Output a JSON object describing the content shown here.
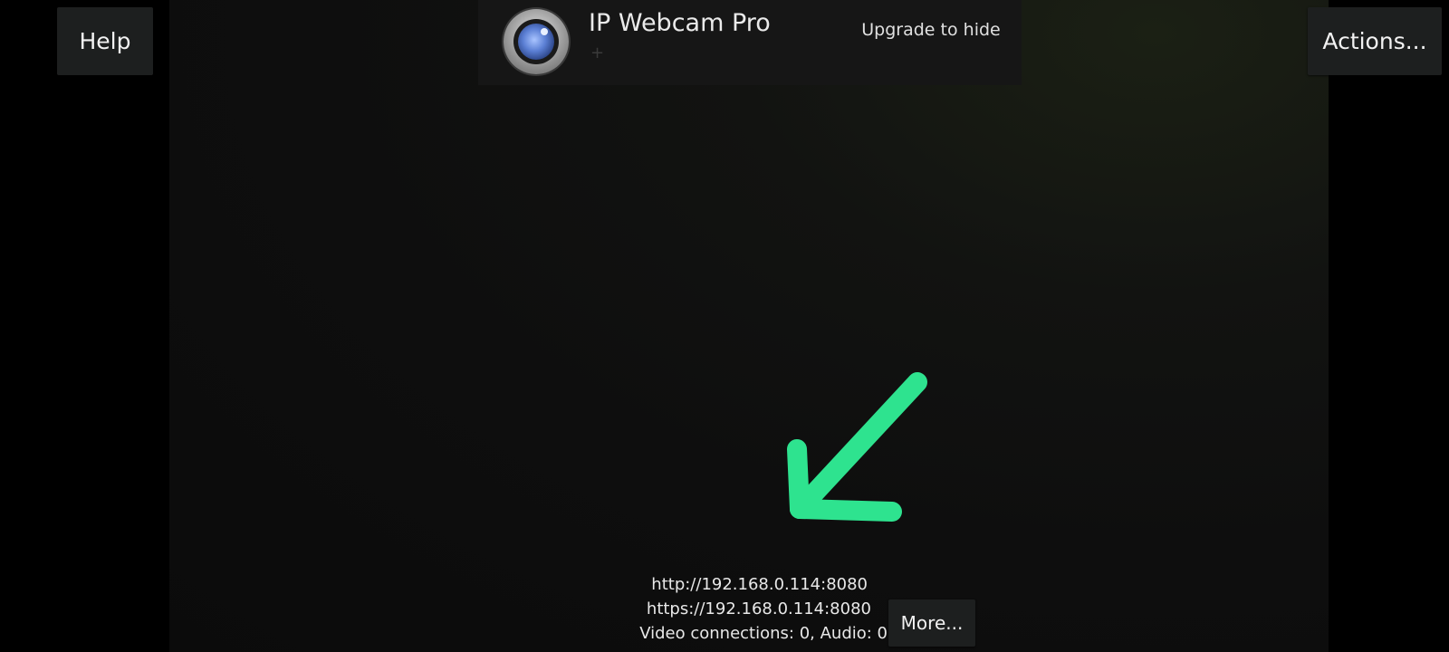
{
  "toolbar": {
    "help_label": "Help",
    "actions_label": "Actions...",
    "more_label": "More..."
  },
  "ad_banner": {
    "title": "IP Webcam Pro",
    "subtitle": "+",
    "upgrade_text": "Upgrade to hide",
    "icon": "webcam-lens-icon"
  },
  "status": {
    "http_url": "http://192.168.0.114:8080",
    "https_url": "https://192.168.0.114:8080",
    "connections": "Video connections: 0, Audio: 0"
  },
  "annotation": {
    "arrow_icon": "hand-drawn-arrow-icon",
    "arrow_color": "#2ee38f"
  },
  "colors": {
    "background": "#000000",
    "button_bg": "#1d1f1f",
    "banner_bg": "#161616"
  }
}
